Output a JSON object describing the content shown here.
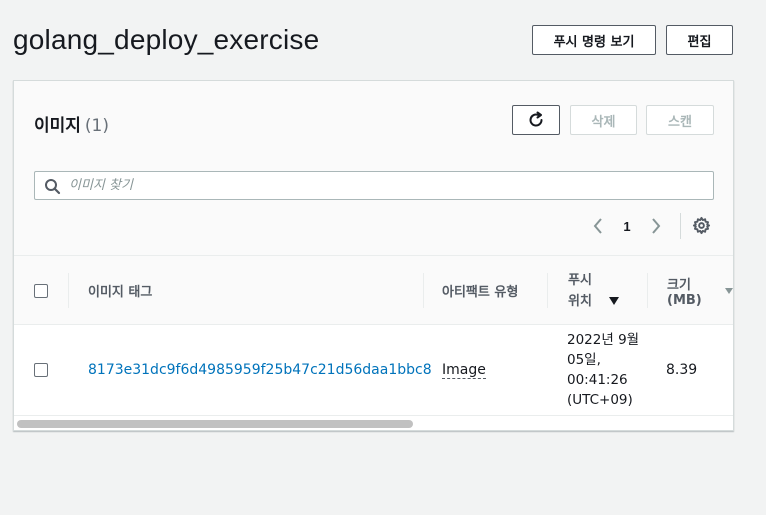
{
  "header": {
    "title": "golang_deploy_exercise",
    "push_label": "푸시 명령 보기",
    "edit_label": "편집"
  },
  "images_panel": {
    "title": "이미지",
    "count": "(1)",
    "delete_label": "삭제",
    "scan_label": "스캔",
    "search_placeholder": "이미지 찾기",
    "page": "1"
  },
  "table": {
    "columns": {
      "tag": "이미지 태그",
      "artifact": "아티팩트 유형",
      "pushed_line1": "푸시",
      "pushed_line2": "위치",
      "size": "크기(MB)"
    },
    "rows": [
      {
        "tag": "8173e31dc9f6d4985959f25b47c21d56daa1bbc8",
        "artifact": "Image",
        "pushed": "2022년 9월 05일, 00:41:26 (UTC+09)",
        "size": "8.39"
      }
    ]
  },
  "icons": [
    "refresh-icon",
    "search-icon",
    "chevron-left-icon",
    "chevron-right-icon",
    "gear-icon",
    "sort-down-icon"
  ],
  "colors": {
    "link": "#0073bb",
    "border": "#545b64",
    "background": "#f2f3f3"
  }
}
